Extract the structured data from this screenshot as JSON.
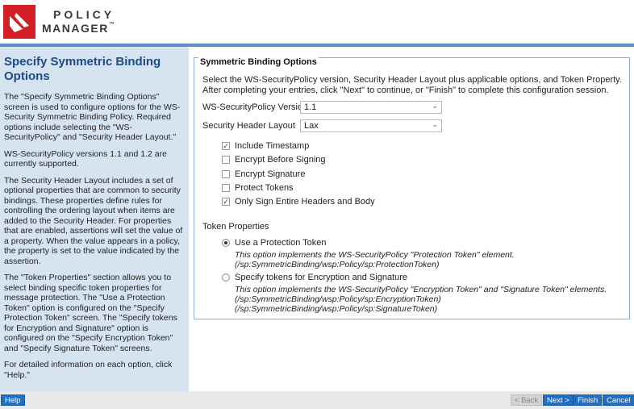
{
  "header": {
    "logo_line1": "POLICY",
    "logo_line2": "MANAGER",
    "logo_tm": "™"
  },
  "left_panel": {
    "title": "Specify Symmetric Binding Options",
    "paragraphs": [
      "The \"Specify Symmetric Binding Options\" screen is used to configure options for the WS-Security Symmetric Binding Policy. Required options include selecting the \"WS-SecurityPolicy\" and \"Security Header Layout.\"",
      "WS-SecurityPolicy versions 1.1 and 1.2 are currently supported.",
      "The Security Header Layout includes a set of optional properties that are common to security bindings. These properties define rules for controlling the ordering layout when items are added to the Security Header. For properties that are enabled, assertions will set the value of a property. When the value appears in a policy, the property is set to the value indicated by the assertion.",
      "The \"Token Properties\" section allows you to select binding specific token properties for message protection. The \"Use a Protection Token\" option is configured on the \"Specify Protection Token\" screen. The \"Specify tokens for Encryption and Signature\" option is configured on the \"Specify Encryption Token\" and \"Specify Signature Token\" screens.",
      "For detailed information on each option, click \"Help.\""
    ]
  },
  "main": {
    "legend": "Symmetric Binding Options",
    "intro": "Select the WS-SecurityPolicy version, Security Header Layout plus applicable options, and Token Property. After completing your entries, click \"Next\" to continue, or \"Finish\" to complete this configuration session.",
    "version_label": "WS-SecurityPolicy Version",
    "version_value": "1.1",
    "layout_label": "Security Header Layout",
    "layout_value": "Lax",
    "checkboxes": [
      {
        "label": "Include Timestamp",
        "checked": true
      },
      {
        "label": "Encrypt Before Signing",
        "checked": false
      },
      {
        "label": "Encrypt Signature",
        "checked": false
      },
      {
        "label": "Protect Tokens",
        "checked": false
      },
      {
        "label": "Only Sign Entire Headers and Body",
        "checked": true
      }
    ],
    "token_heading": "Token Properties",
    "radio1": {
      "label": "Use a Protection Token",
      "selected": true,
      "desc1": "This option implements the WS-SecurityPolicy \"Protection Token\" element.",
      "desc2": "(/sp:SymmetricBinding/wsp:Policy/sp:ProtectionToken)"
    },
    "radio2": {
      "label": "Specify tokens for Encryption and Signature",
      "selected": false,
      "desc1": "This option implements the WS-SecurityPolicy \"Encryption Token\" and \"Signature Token\" elements.",
      "desc2": "(/sp:SymmetricBinding/wsp:Policy/sp:EncryptionToken)",
      "desc3": "(/sp:SymmetricBinding/wsp:Policy/sp:SignatureToken)"
    }
  },
  "footer": {
    "help": "Help",
    "back": "< Back",
    "next": "Next >",
    "finish": "Finish",
    "cancel": "Cancel"
  },
  "colors": {
    "accent": "#5d8fc4",
    "button": "#1f6fc4",
    "panel": "#d6e3f1",
    "logo_red": "#d21f26"
  }
}
